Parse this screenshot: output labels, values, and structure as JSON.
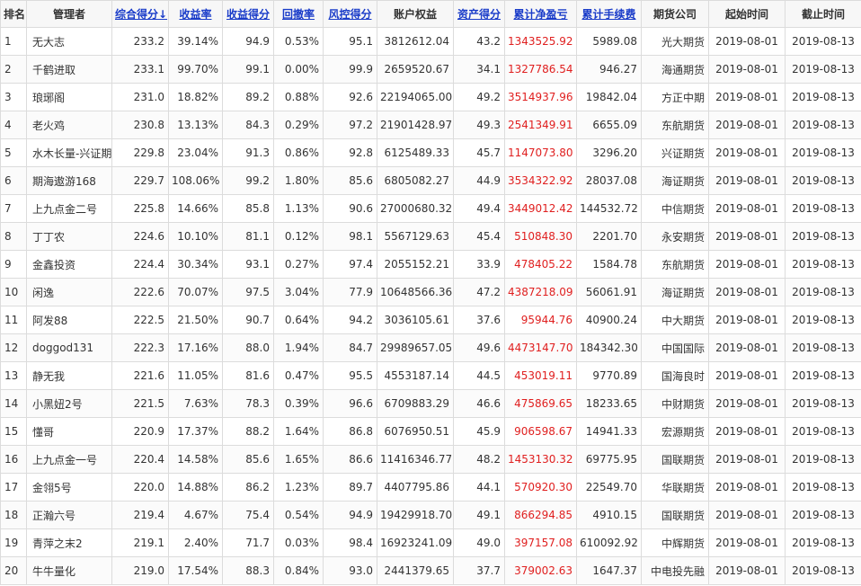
{
  "headers": [
    {
      "key": "rank",
      "label": "排名",
      "sortable": false
    },
    {
      "key": "manager",
      "label": "管理者",
      "sortable": false
    },
    {
      "key": "total",
      "label": "综合得分↓",
      "sortable": true
    },
    {
      "key": "return_rate",
      "label": "收益率",
      "sortable": true
    },
    {
      "key": "return_score",
      "label": "收益得分",
      "sortable": true
    },
    {
      "key": "drawdown",
      "label": "回撤率",
      "sortable": true
    },
    {
      "key": "risk_score",
      "label": "风控得分",
      "sortable": true
    },
    {
      "key": "equity",
      "label": "账户权益",
      "sortable": false
    },
    {
      "key": "asset_score",
      "label": "资产得分",
      "sortable": true
    },
    {
      "key": "net_pnl",
      "label": "累计净盈亏",
      "sortable": true
    },
    {
      "key": "fee",
      "label": "累计手续费",
      "sortable": true
    },
    {
      "key": "broker",
      "label": "期货公司",
      "sortable": false
    },
    {
      "key": "start",
      "label": "起始时间",
      "sortable": false
    },
    {
      "key": "end",
      "label": "截止时间",
      "sortable": false
    }
  ],
  "rows": [
    [
      "1",
      "无大志",
      "233.2",
      "39.14%",
      "94.9",
      "0.53%",
      "95.1",
      "3812612.04",
      "43.2",
      "1343525.92",
      "5989.08",
      "光大期货",
      "2019-08-01",
      "2019-08-13"
    ],
    [
      "2",
      "千鹤进取",
      "233.1",
      "99.70%",
      "99.1",
      "0.00%",
      "99.9",
      "2659520.67",
      "34.1",
      "1327786.54",
      "946.27",
      "海通期货",
      "2019-08-01",
      "2019-08-13"
    ],
    [
      "3",
      "琅琊阁",
      "231.0",
      "18.82%",
      "89.2",
      "0.88%",
      "92.6",
      "22194065.00",
      "49.2",
      "3514937.96",
      "19842.04",
      "方正中期",
      "2019-08-01",
      "2019-08-13"
    ],
    [
      "4",
      "老火鸡",
      "230.8",
      "13.13%",
      "84.3",
      "0.29%",
      "97.2",
      "21901428.97",
      "49.3",
      "2541349.91",
      "6655.09",
      "东航期货",
      "2019-08-01",
      "2019-08-13"
    ],
    [
      "5",
      "水木长量-兴证期",
      "229.8",
      "23.04%",
      "91.3",
      "0.86%",
      "92.8",
      "6125489.33",
      "45.7",
      "1147073.80",
      "3296.20",
      "兴证期货",
      "2019-08-01",
      "2019-08-13"
    ],
    [
      "6",
      "期海遨游168",
      "229.7",
      "108.06%",
      "99.2",
      "1.80%",
      "85.6",
      "6805082.27",
      "44.9",
      "3534322.92",
      "28037.08",
      "海证期货",
      "2019-08-01",
      "2019-08-13"
    ],
    [
      "7",
      "上九点金二号",
      "225.8",
      "14.66%",
      "85.8",
      "1.13%",
      "90.6",
      "27000680.32",
      "49.4",
      "3449012.42",
      "144532.72",
      "中信期货",
      "2019-08-01",
      "2019-08-13"
    ],
    [
      "8",
      "丁丁农",
      "224.6",
      "10.10%",
      "81.1",
      "0.12%",
      "98.1",
      "5567129.63",
      "45.4",
      "510848.30",
      "2201.70",
      "永安期货",
      "2019-08-01",
      "2019-08-13"
    ],
    [
      "9",
      "金鑫投资",
      "224.4",
      "30.34%",
      "93.1",
      "0.27%",
      "97.4",
      "2055152.21",
      "33.9",
      "478405.22",
      "1584.78",
      "东航期货",
      "2019-08-01",
      "2019-08-13"
    ],
    [
      "10",
      "闲逸",
      "222.6",
      "70.07%",
      "97.5",
      "3.04%",
      "77.9",
      "10648566.36",
      "47.2",
      "4387218.09",
      "56061.91",
      "海证期货",
      "2019-08-01",
      "2019-08-13"
    ],
    [
      "11",
      "阿发88",
      "222.5",
      "21.50%",
      "90.7",
      "0.64%",
      "94.2",
      "3036105.61",
      "37.6",
      "95944.76",
      "40900.24",
      "中大期货",
      "2019-08-01",
      "2019-08-13"
    ],
    [
      "12",
      "doggod131",
      "222.3",
      "17.16%",
      "88.0",
      "1.94%",
      "84.7",
      "29989657.05",
      "49.6",
      "4473147.70",
      "184342.30",
      "中国国际",
      "2019-08-01",
      "2019-08-13"
    ],
    [
      "13",
      "静无我",
      "221.6",
      "11.05%",
      "81.6",
      "0.47%",
      "95.5",
      "4553187.14",
      "44.5",
      "453019.11",
      "9770.89",
      "国海良时",
      "2019-08-01",
      "2019-08-13"
    ],
    [
      "14",
      "小黑妞2号",
      "221.5",
      "7.63%",
      "78.3",
      "0.39%",
      "96.6",
      "6709883.29",
      "46.6",
      "475869.65",
      "18233.65",
      "中财期货",
      "2019-08-01",
      "2019-08-13"
    ],
    [
      "15",
      "懂哥",
      "220.9",
      "17.37%",
      "88.2",
      "1.64%",
      "86.8",
      "6076950.51",
      "45.9",
      "906598.67",
      "14941.33",
      "宏源期货",
      "2019-08-01",
      "2019-08-13"
    ],
    [
      "16",
      "上九点金一号",
      "220.4",
      "14.58%",
      "85.6",
      "1.65%",
      "86.6",
      "11416346.77",
      "48.2",
      "1453130.32",
      "69775.95",
      "国联期货",
      "2019-08-01",
      "2019-08-13"
    ],
    [
      "17",
      "金翎5号",
      "220.0",
      "14.88%",
      "86.2",
      "1.23%",
      "89.7",
      "4407795.86",
      "44.1",
      "570920.30",
      "22549.70",
      "华联期货",
      "2019-08-01",
      "2019-08-13"
    ],
    [
      "18",
      "正瀚六号",
      "219.4",
      "4.67%",
      "75.4",
      "0.54%",
      "94.9",
      "19429918.70",
      "49.1",
      "866294.85",
      "4910.15",
      "国联期货",
      "2019-08-01",
      "2019-08-13"
    ],
    [
      "19",
      "青萍之末2",
      "219.1",
      "2.40%",
      "71.7",
      "0.03%",
      "98.4",
      "16923241.09",
      "49.0",
      "397157.08",
      "610092.92",
      "中辉期货",
      "2019-08-01",
      "2019-08-13"
    ],
    [
      "20",
      "牛牛量化",
      "219.0",
      "17.54%",
      "88.3",
      "0.84%",
      "93.0",
      "2441379.65",
      "37.7",
      "379002.63",
      "1647.37",
      "中电投先融",
      "2019-08-01",
      "2019-08-13"
    ]
  ],
  "colors": {
    "link": "#1a3cc9",
    "pnl": "#e02020",
    "header_bg": "#f7f7f7",
    "border": "#dcdcdc"
  }
}
